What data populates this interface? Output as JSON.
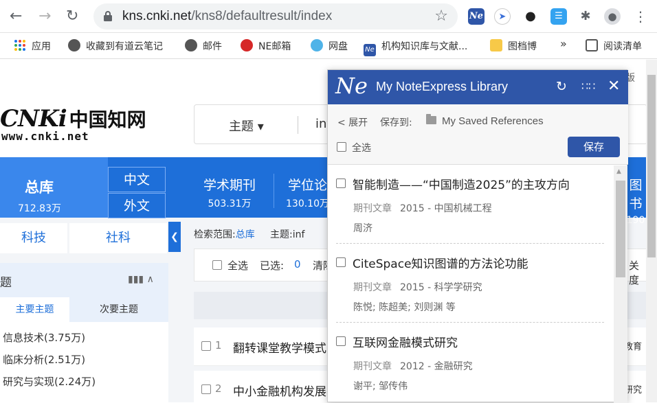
{
  "browser": {
    "url_host": "kns.cnki.net",
    "url_path": "/kns8/defaultresult/index"
  },
  "bookmarks": [
    {
      "label": "应用",
      "icon": "apps-grid-icon"
    },
    {
      "label": "收藏到有道云笔记",
      "icon": "globe-icon"
    },
    {
      "label": "邮件",
      "icon": "globe-icon"
    },
    {
      "label": "NE邮箱",
      "icon": "netease-icon"
    },
    {
      "label": "网盘",
      "icon": "cloud-drive-icon"
    },
    {
      "label": "机构知识库与文献...",
      "icon": "noteexpress-icon"
    },
    {
      "label": "图档博",
      "icon": "folder-icon"
    },
    {
      "label": "阅读清单",
      "icon": "reading-list-icon"
    }
  ],
  "cnki": {
    "logo_main": "CNKi",
    "logo_cn": "中国知网",
    "logo_url": "www.cnki.net",
    "search_field": "主题",
    "search_query": "int",
    "old_version": "旧版",
    "zongku": {
      "label": "总库",
      "count": "712.83万"
    },
    "lang_zh": "中文",
    "lang_en": "外文",
    "nav": [
      {
        "label": "学术期刊",
        "count": "503.31万"
      },
      {
        "label": "学位论",
        "count": "130.10万"
      },
      {
        "label": "图书",
        "count": "190"
      }
    ],
    "cat_sci": "科技",
    "cat_social": "社科",
    "scope_label": "检索范围:",
    "scope_value": "总库",
    "scope_topic_label": "主题:",
    "scope_topic_value": "inf",
    "select_all": "全选",
    "selected_label": "已选:",
    "selected_count": "0",
    "clear": "清除",
    "relevance": "关度",
    "panel_title": "题",
    "panel_tab_main": "主要主题",
    "panel_tab_sub": "次要主题",
    "topics": [
      "信息技术(3.75万)",
      "临床分析(2.51万)",
      "研究与实现(2.24万)"
    ],
    "results": [
      {
        "num": "1",
        "title": "翻转课堂教学模式",
        "tag": "教育"
      },
      {
        "num": "2",
        "title": "中小金融机构发展",
        "tag": "研究"
      }
    ]
  },
  "popup": {
    "logo": "Ne",
    "title": "My NoteExpress Library",
    "expand": "< 展开",
    "save_to": "保存到:",
    "folder": "My Saved References",
    "select_all": "全选",
    "save_button": "保存",
    "refs": [
      {
        "title": "智能制造——“中国制造2025”的主攻方向",
        "type": "期刊文章",
        "meta": "2015 - 中国机械工程",
        "authors": "周济"
      },
      {
        "title": "CiteSpace知识图谱的方法论功能",
        "type": "期刊文章",
        "meta": "2015 - 科学学研究",
        "authors": "陈悦; 陈超美; 刘则渊 等"
      },
      {
        "title": "互联网金融模式研究",
        "type": "期刊文章",
        "meta": "2012 - 金融研究",
        "authors": "谢平; 邹传伟"
      }
    ]
  }
}
